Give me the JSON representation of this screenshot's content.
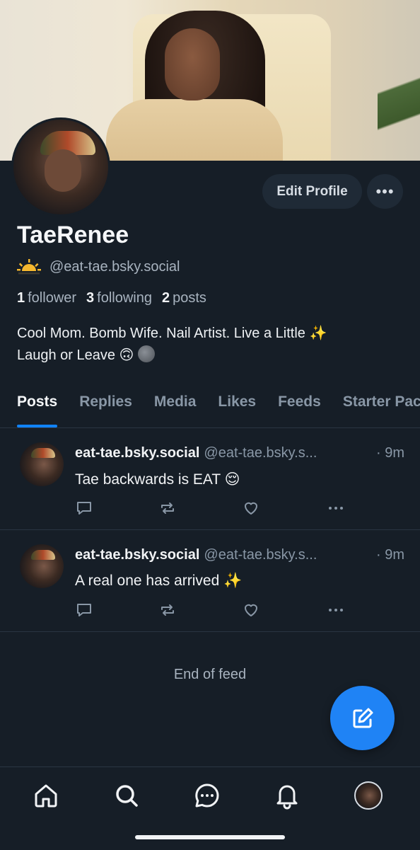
{
  "profile": {
    "display_name": "TaeRenee",
    "handle": "@eat-tae.bsky.social",
    "followers_count": "1",
    "followers_label": "follower",
    "following_count": "3",
    "following_label": "following",
    "posts_count": "2",
    "posts_label": "posts",
    "bio_line1": "Cool Mom. Bomb Wife. Nail Artist. Live a Little ✨",
    "bio_line2": "Laugh or Leave 🙃",
    "edit_button": "Edit Profile",
    "more_button": "•••"
  },
  "tabs": [
    "Posts",
    "Replies",
    "Media",
    "Likes",
    "Feeds",
    "Starter Packs"
  ],
  "posts": [
    {
      "author": "eat-tae.bsky.social",
      "handle": "@eat-tae.bsky.s...",
      "time": "· 9m",
      "text": "Tae backwards is EAT 😌"
    },
    {
      "author": "eat-tae.bsky.social",
      "handle": "@eat-tae.bsky.s...",
      "time": "· 9m",
      "text": "A real one has arrived ✨"
    }
  ],
  "feed_end": "End of feed",
  "icons": {
    "reply": "reply-icon",
    "repost": "repost-icon",
    "like": "heart-icon",
    "more": "more-icon",
    "compose": "compose-icon",
    "nav_home": "home-icon",
    "nav_search": "search-icon",
    "nav_chat": "chat-icon",
    "nav_notifications": "bell-icon"
  },
  "colors": {
    "background": "#161e27",
    "accent": "#1083fe",
    "muted": "#8997a6"
  }
}
